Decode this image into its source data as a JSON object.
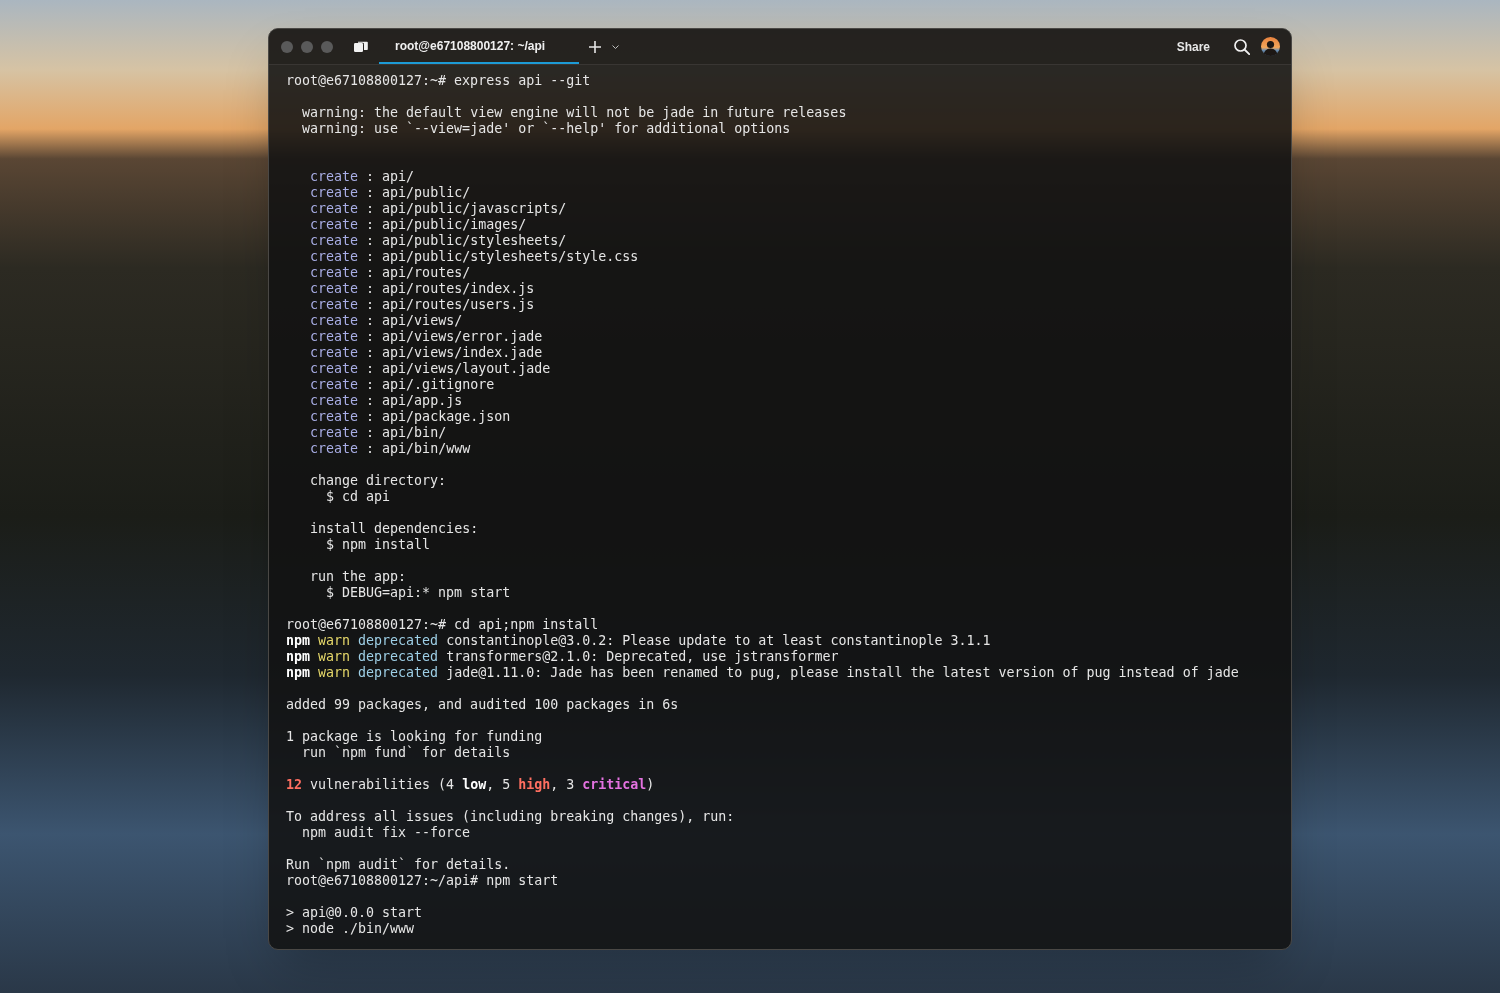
{
  "window": {
    "tabs": [
      {
        "title": "root@e67108800127: ~/api",
        "selected": true
      }
    ],
    "share_button": "Share"
  },
  "terminal": {
    "lines": [
      {
        "kind": "prompt",
        "text": "root@e67108800127:~# express api --git"
      },
      {
        "kind": "blank"
      },
      {
        "kind": "output",
        "text": "  warning: the default view engine will not be jade in future releases"
      },
      {
        "kind": "output",
        "text": "  warning: use `--view=jade' or `--help' for additional options"
      },
      {
        "kind": "blank"
      },
      {
        "kind": "blank"
      },
      {
        "kind": "output",
        "segments": [
          {
            "text": "   create",
            "kind": "action"
          },
          {
            "text": " : api/",
            "kind": "plain"
          }
        ]
      },
      {
        "kind": "output",
        "segments": [
          {
            "text": "   create",
            "kind": "action"
          },
          {
            "text": " : api/public/",
            "kind": "plain"
          }
        ]
      },
      {
        "kind": "output",
        "segments": [
          {
            "text": "   create",
            "kind": "action"
          },
          {
            "text": " : api/public/javascripts/",
            "kind": "plain"
          }
        ]
      },
      {
        "kind": "output",
        "segments": [
          {
            "text": "   create",
            "kind": "action"
          },
          {
            "text": " : api/public/images/",
            "kind": "plain"
          }
        ]
      },
      {
        "kind": "output",
        "segments": [
          {
            "text": "   create",
            "kind": "action"
          },
          {
            "text": " : api/public/stylesheets/",
            "kind": "plain"
          }
        ]
      },
      {
        "kind": "output",
        "segments": [
          {
            "text": "   create",
            "kind": "action"
          },
          {
            "text": " : api/public/stylesheets/style.css",
            "kind": "plain"
          }
        ]
      },
      {
        "kind": "output",
        "segments": [
          {
            "text": "   create",
            "kind": "action"
          },
          {
            "text": " : api/routes/",
            "kind": "plain"
          }
        ]
      },
      {
        "kind": "output",
        "segments": [
          {
            "text": "   create",
            "kind": "action"
          },
          {
            "text": " : api/routes/index.js",
            "kind": "plain"
          }
        ]
      },
      {
        "kind": "output",
        "segments": [
          {
            "text": "   create",
            "kind": "action"
          },
          {
            "text": " : api/routes/users.js",
            "kind": "plain"
          }
        ]
      },
      {
        "kind": "output",
        "segments": [
          {
            "text": "   create",
            "kind": "action"
          },
          {
            "text": " : api/views/",
            "kind": "plain"
          }
        ]
      },
      {
        "kind": "output",
        "segments": [
          {
            "text": "   create",
            "kind": "action"
          },
          {
            "text": " : api/views/error.jade",
            "kind": "plain"
          }
        ]
      },
      {
        "kind": "output",
        "segments": [
          {
            "text": "   create",
            "kind": "action"
          },
          {
            "text": " : api/views/index.jade",
            "kind": "plain"
          }
        ]
      },
      {
        "kind": "output",
        "segments": [
          {
            "text": "   create",
            "kind": "action"
          },
          {
            "text": " : api/views/layout.jade",
            "kind": "plain"
          }
        ]
      },
      {
        "kind": "output",
        "segments": [
          {
            "text": "   create",
            "kind": "action"
          },
          {
            "text": " : api/.gitignore",
            "kind": "plain"
          }
        ]
      },
      {
        "kind": "output",
        "segments": [
          {
            "text": "   create",
            "kind": "action"
          },
          {
            "text": " : api/app.js",
            "kind": "plain"
          }
        ]
      },
      {
        "kind": "output",
        "segments": [
          {
            "text": "   create",
            "kind": "action"
          },
          {
            "text": " : api/package.json",
            "kind": "plain"
          }
        ]
      },
      {
        "kind": "output",
        "segments": [
          {
            "text": "   create",
            "kind": "action"
          },
          {
            "text": " : api/bin/",
            "kind": "plain"
          }
        ]
      },
      {
        "kind": "output",
        "segments": [
          {
            "text": "   create",
            "kind": "action"
          },
          {
            "text": " : api/bin/www",
            "kind": "plain"
          }
        ]
      },
      {
        "kind": "blank"
      },
      {
        "kind": "output",
        "text": "   change directory:"
      },
      {
        "kind": "output",
        "text": "     $ cd api"
      },
      {
        "kind": "blank"
      },
      {
        "kind": "output",
        "text": "   install dependencies:"
      },
      {
        "kind": "output",
        "text": "     $ npm install"
      },
      {
        "kind": "blank"
      },
      {
        "kind": "output",
        "text": "   run the app:"
      },
      {
        "kind": "output",
        "text": "     $ DEBUG=api:* npm start"
      },
      {
        "kind": "blank"
      },
      {
        "kind": "prompt",
        "text": "root@e67108800127:~# cd api;npm install"
      },
      {
        "kind": "output",
        "segments": [
          {
            "text": "npm",
            "kind": "strong"
          },
          {
            "text": " warn",
            "kind": "warning"
          },
          {
            "text": " deprecated",
            "kind": "notice"
          },
          {
            "text": " constantinople@3.0.2: Please update to at least constantinople 3.1.1",
            "kind": "plain"
          }
        ]
      },
      {
        "kind": "output",
        "segments": [
          {
            "text": "npm",
            "kind": "strong"
          },
          {
            "text": " warn",
            "kind": "warning"
          },
          {
            "text": " deprecated",
            "kind": "notice"
          },
          {
            "text": " transformers@2.1.0: Deprecated, use jstransformer",
            "kind": "plain"
          }
        ]
      },
      {
        "kind": "output",
        "segments": [
          {
            "text": "npm",
            "kind": "strong"
          },
          {
            "text": " warn",
            "kind": "warning"
          },
          {
            "text": " deprecated",
            "kind": "notice"
          },
          {
            "text": " jade@1.11.0: Jade has been renamed to pug, please install the latest version of pug instead of jade",
            "kind": "plain"
          }
        ]
      },
      {
        "kind": "blank"
      },
      {
        "kind": "output",
        "text": "added 99 packages, and audited 100 packages in 6s"
      },
      {
        "kind": "blank"
      },
      {
        "kind": "output",
        "text": "1 package is looking for funding"
      },
      {
        "kind": "output",
        "text": "  run `npm fund` for details"
      },
      {
        "kind": "blank"
      },
      {
        "kind": "output",
        "segments": [
          {
            "text": "12",
            "kind": "danger"
          },
          {
            "text": " vulnerabilities (4 ",
            "kind": "plain"
          },
          {
            "text": "low",
            "kind": "strong"
          },
          {
            "text": ", 5 ",
            "kind": "plain"
          },
          {
            "text": "high",
            "kind": "danger"
          },
          {
            "text": ", 3 ",
            "kind": "plain"
          },
          {
            "text": "critical",
            "kind": "critical"
          },
          {
            "text": ")",
            "kind": "plain"
          }
        ]
      },
      {
        "kind": "blank"
      },
      {
        "kind": "output",
        "text": "To address all issues (including breaking changes), run:"
      },
      {
        "kind": "output",
        "text": "  npm audit fix --force"
      },
      {
        "kind": "blank"
      },
      {
        "kind": "output",
        "text": "Run `npm audit` for details."
      },
      {
        "kind": "prompt",
        "text": "root@e67108800127:~/api# npm start"
      },
      {
        "kind": "blank"
      },
      {
        "kind": "output",
        "text": "> api@0.0.0 start"
      },
      {
        "kind": "output",
        "text": "> node ./bin/www"
      }
    ]
  }
}
